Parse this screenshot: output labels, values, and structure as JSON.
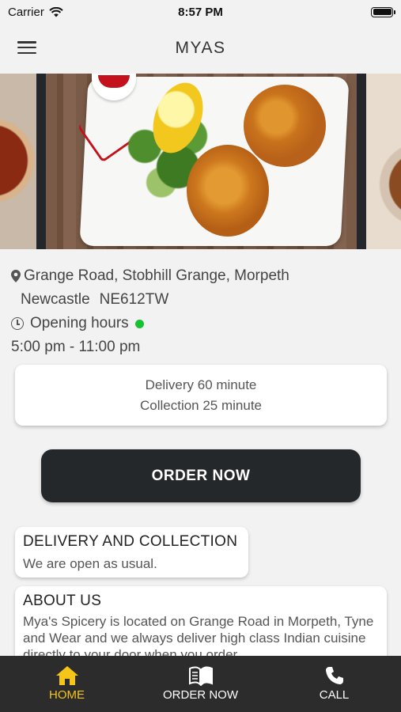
{
  "status_bar": {
    "carrier": "Carrier",
    "time": "8:57 PM"
  },
  "header": {
    "title": "MYAS"
  },
  "restaurant": {
    "address_line1": "Grange Road, Stobhill Grange, Morpeth",
    "city": "Newcastle",
    "postcode": "NE612TW",
    "opening_label": "Opening hours",
    "hours": "5:00 pm - 11:00 pm",
    "is_open": true,
    "open_color": "#16c132"
  },
  "timings": {
    "delivery": "Delivery 60 minute",
    "collection": "Collection 25 minute"
  },
  "order_button": {
    "label": "ORDER NOW"
  },
  "delivery_card": {
    "title": "DELIVERY AND COLLECTION",
    "text": "We are open as usual."
  },
  "about_card": {
    "title": "ABOUT US",
    "text": "Mya's Spicery is located on Grange Road in Morpeth, Tyne and Wear and we always deliver high class Indian cuisine directly to your door when you order"
  },
  "tabs": [
    {
      "label": "HOME",
      "icon": "home-icon",
      "active": true
    },
    {
      "label": "ORDER NOW",
      "icon": "menu-book-icon",
      "active": false
    },
    {
      "label": "CALL",
      "icon": "phone-icon",
      "active": false
    }
  ],
  "colors": {
    "accent": "#f5c518",
    "dark": "#25282b",
    "tab_bar": "#2c2c2c"
  }
}
